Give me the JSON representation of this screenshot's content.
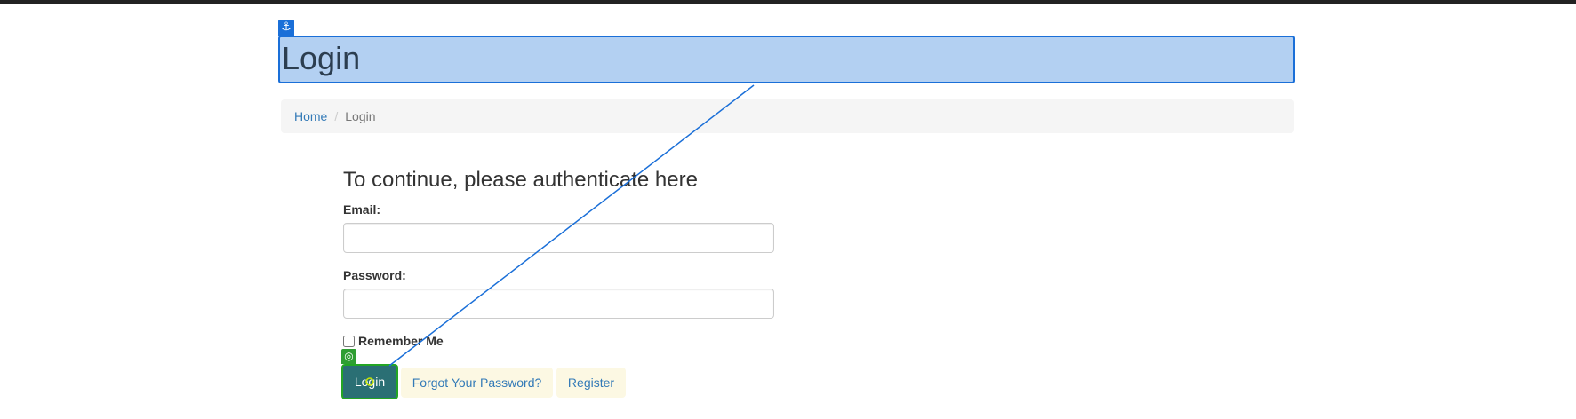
{
  "page": {
    "title": "Login"
  },
  "overlay": {
    "anchor_icon": "anchor-icon",
    "anchor_glyph": "⚓",
    "target_icon": "target-icon",
    "target_glyph": "◎",
    "highlight_color": "#1a6fd8",
    "target_color": "#2e9e32"
  },
  "breadcrumb": {
    "home": "Home",
    "separator": "/",
    "current": "Login"
  },
  "form": {
    "heading": "To continue, please authenticate here",
    "email_label": "Email:",
    "email_value": "",
    "password_label": "Password:",
    "password_value": "",
    "remember_label": "Remember Me",
    "remember_checked": false,
    "login_label": "Login",
    "forgot_label": "Forgot Your Password?",
    "register_label": "Register"
  },
  "colors": {
    "login_button": "#2a6f74",
    "link": "#337ab7",
    "link_button_bg": "#fcf8e3"
  }
}
